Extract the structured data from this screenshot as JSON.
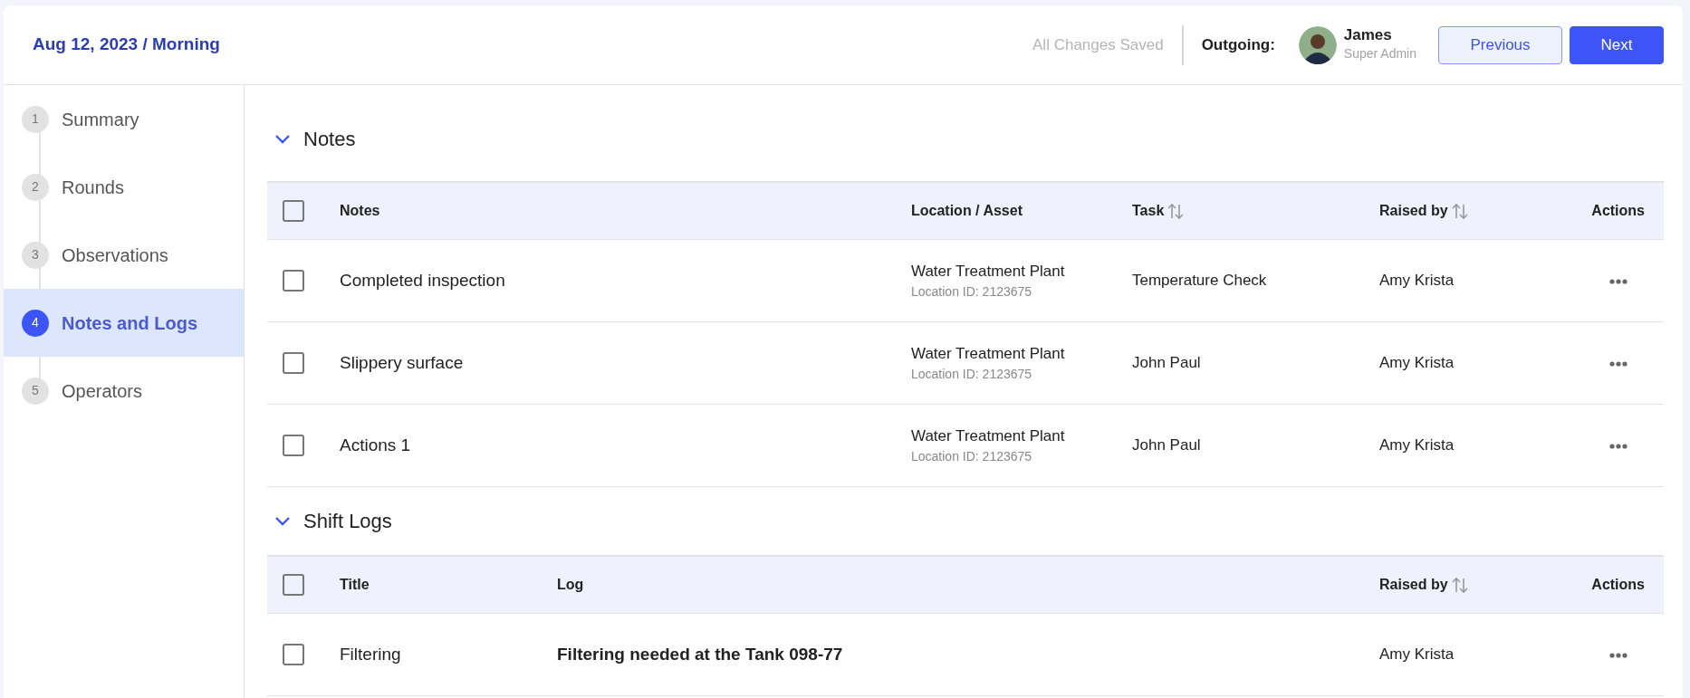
{
  "header": {
    "title": "Aug 12, 2023 / Morning",
    "save_status": "All Changes Saved",
    "outgoing_label": "Outgoing:",
    "user": {
      "name": "James",
      "role": "Super Admin"
    },
    "buttons": [
      {
        "label": "Previous",
        "kind": "secondary"
      },
      {
        "label": "Next",
        "kind": "primary"
      }
    ]
  },
  "steps": [
    {
      "number": "1",
      "label": "Summary",
      "selected": false
    },
    {
      "number": "2",
      "label": "Rounds",
      "selected": false
    },
    {
      "number": "3",
      "label": "Observations",
      "selected": false
    },
    {
      "number": "4",
      "label": "Notes and Logs",
      "selected": true
    },
    {
      "number": "5",
      "label": "Operators",
      "selected": false
    }
  ],
  "sections": [
    {
      "title": "Notes",
      "kind": "notes",
      "expanded": true,
      "header_checked": false,
      "columns": [
        {
          "label": "Notes",
          "sortable": false
        },
        {
          "label": "Location / Asset",
          "sortable": false
        },
        {
          "label": "Task",
          "sortable": true
        },
        {
          "label": "Raised by",
          "sortable": true
        },
        {
          "label": "Actions",
          "sortable": false
        }
      ],
      "rows": [
        {
          "checked": false,
          "title": "Completed inspection",
          "location": "Water Treatment Plant",
          "location_id": "Location ID: 2123675",
          "task": "Temperature Check",
          "raised_by": "Amy Krista"
        },
        {
          "checked": false,
          "title": "Slippery surface",
          "location": "Water Treatment Plant",
          "location_id": "Location ID: 2123675",
          "task": "John Paul",
          "raised_by": "Amy Krista"
        },
        {
          "checked": false,
          "title": "Actions 1",
          "location": "Water Treatment Plant",
          "location_id": "Location ID: 2123675",
          "task": "John Paul",
          "raised_by": "Amy Krista"
        }
      ]
    },
    {
      "title": "Shift Logs",
      "kind": "logs",
      "expanded": true,
      "header_checked": false,
      "columns": [
        {
          "label": "Title",
          "sortable": false
        },
        {
          "label": "Log",
          "sortable": false
        },
        {
          "label": "Raised by",
          "sortable": true
        },
        {
          "label": "Actions",
          "sortable": false
        }
      ],
      "rows": [
        {
          "checked": false,
          "title": "Filtering",
          "log": "Filtering needed at the Tank 098-77",
          "raised_by": "Amy Krista"
        }
      ]
    }
  ]
}
